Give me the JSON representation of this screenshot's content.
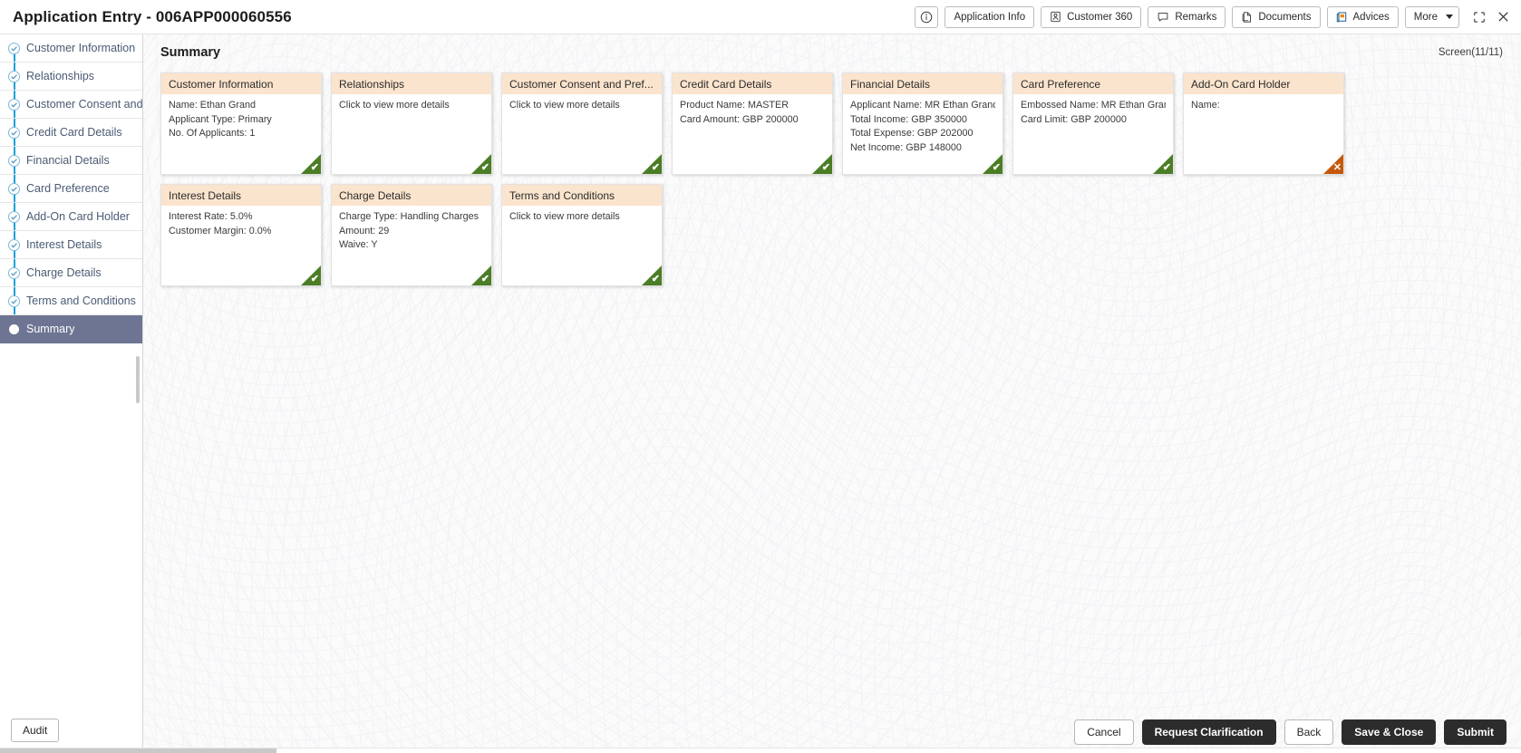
{
  "titlebar": {
    "title": "Application Entry - 006APP000060556",
    "info_icon": "info-circle-icon",
    "actions": [
      {
        "label": "Application Info",
        "icon": "none"
      },
      {
        "label": "Customer 360",
        "icon": "user-card-icon"
      },
      {
        "label": "Remarks",
        "icon": "speech-bubble-icon"
      },
      {
        "label": "Documents",
        "icon": "document-icon"
      },
      {
        "label": "Advices",
        "icon": "advices-icon"
      },
      {
        "label": "More",
        "icon": "caret-down-icon"
      }
    ],
    "window_controls": [
      {
        "name": "minimize-restore-icon"
      },
      {
        "name": "close-icon"
      }
    ]
  },
  "sidebar": {
    "items": [
      {
        "label": "Customer Information",
        "state": "done"
      },
      {
        "label": "Relationships",
        "state": "done"
      },
      {
        "label": "Customer Consent and  ...",
        "state": "done"
      },
      {
        "label": "Credit Card Details",
        "state": "done"
      },
      {
        "label": "Financial Details",
        "state": "done"
      },
      {
        "label": "Card Preference",
        "state": "done"
      },
      {
        "label": "Add-On Card Holder",
        "state": "done"
      },
      {
        "label": "Interest Details",
        "state": "done"
      },
      {
        "label": "Charge Details",
        "state": "done"
      },
      {
        "label": "Terms and Conditions",
        "state": "done"
      },
      {
        "label": "Summary",
        "state": "current"
      }
    ],
    "audit_label": "Audit"
  },
  "main": {
    "page_title": "Summary",
    "screen_count": "Screen(11/11)",
    "cards": [
      {
        "title": "Customer Information",
        "lines": [
          "Name: Ethan Grand",
          "Applicant Type: Primary",
          "No. Of Applicants: 1"
        ],
        "status": "ok",
        "mark": "✔"
      },
      {
        "title": "Relationships",
        "lines": [
          "Click to view more details"
        ],
        "status": "ok",
        "mark": "✔"
      },
      {
        "title": "Customer Consent and Pref...",
        "lines": [
          "Click to view more details"
        ],
        "status": "ok",
        "mark": "✔"
      },
      {
        "title": "Credit Card Details",
        "lines": [
          "Product Name: MASTER",
          "Card Amount: GBP 200000"
        ],
        "status": "ok",
        "mark": "✔"
      },
      {
        "title": "Financial Details",
        "lines": [
          "Applicant Name: MR Ethan Grand",
          "Total Income: GBP 350000",
          "Total Expense: GBP 202000",
          "Net Income: GBP 148000"
        ],
        "status": "ok",
        "mark": "✔"
      },
      {
        "title": "Card Preference",
        "lines": [
          "Embossed Name: MR Ethan Grand",
          "Card Limit: GBP 200000"
        ],
        "status": "ok",
        "mark": "✔"
      },
      {
        "title": "Add-On Card Holder",
        "lines": [
          "Name:"
        ],
        "status": "err",
        "mark": "✕"
      },
      {
        "title": "Interest Details",
        "lines": [
          "Interest Rate: 5.0%",
          "Customer Margin: 0.0%"
        ],
        "status": "ok",
        "mark": "✔"
      },
      {
        "title": "Charge Details",
        "lines": [
          "Charge Type: Handling Charges",
          "Amount: 29",
          "Waive: Y"
        ],
        "status": "ok",
        "mark": "✔"
      },
      {
        "title": "Terms and Conditions",
        "lines": [
          "Click to view more details"
        ],
        "status": "ok",
        "mark": "✔"
      }
    ]
  },
  "footer": {
    "buttons": [
      {
        "label": "Cancel",
        "style": "ghost"
      },
      {
        "label": "Request Clarification",
        "style": "solid"
      },
      {
        "label": "Back",
        "style": "ghost"
      },
      {
        "label": "Save & Close",
        "style": "solid"
      },
      {
        "label": "Submit",
        "style": "solid"
      }
    ]
  },
  "colors": {
    "accent_rail": "#1a9fd9",
    "current_nav": "#6d7593",
    "card_header": "#fbe4cd",
    "status_ok": "#4b7d25",
    "status_err": "#c4590b",
    "solid_button": "#2c2c2c"
  }
}
